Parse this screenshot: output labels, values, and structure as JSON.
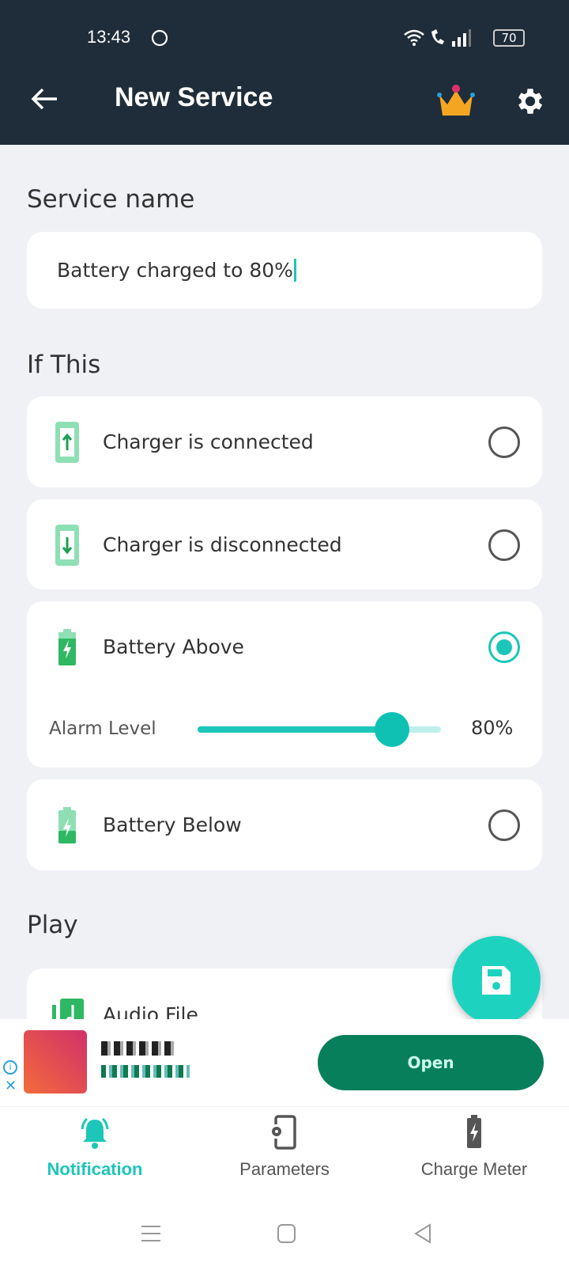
{
  "status_bar": {
    "time": "13:43",
    "battery": "70",
    "icons": [
      "whatsapp-icon",
      "wifi-icon",
      "wifi-call-icon",
      "signal-icon",
      "battery-icon"
    ]
  },
  "app_bar": {
    "title": "New Service",
    "back_icon": "arrow-left-icon",
    "premium_icon": "crown-icon",
    "settings_icon": "gear-icon"
  },
  "service_name": {
    "label": "Service name",
    "value": "Battery charged to 80%"
  },
  "if_this": {
    "label": "If This",
    "options": [
      {
        "label": "Charger is connected",
        "icon": "charger-connected-icon",
        "selected": false
      },
      {
        "label": "Charger is disconnected",
        "icon": "charger-disconnected-icon",
        "selected": false
      },
      {
        "label": "Battery Above",
        "icon": "battery-charging-full-icon",
        "selected": true
      },
      {
        "label": "Battery Below",
        "icon": "battery-charging-low-icon",
        "selected": false
      }
    ],
    "alarm": {
      "label": "Alarm Level",
      "value": 80,
      "value_text": "80%"
    }
  },
  "play": {
    "label": "Play",
    "items": [
      {
        "label": "Audio File",
        "icon": "music-file-icon"
      }
    ]
  },
  "fab": {
    "icon": "save-icon"
  },
  "ad": {
    "button": "Open"
  },
  "bottom_nav": [
    {
      "label": "Notification",
      "icon": "bell-icon",
      "active": true
    },
    {
      "label": "Parameters",
      "icon": "phone-settings-icon",
      "active": false
    },
    {
      "label": "Charge Meter",
      "icon": "battery-charging-icon",
      "active": false
    }
  ],
  "colors": {
    "accent": "#1cc6b9",
    "header": "#1f2d3a",
    "green": "#2fb864",
    "ad_button": "#087f5b"
  }
}
